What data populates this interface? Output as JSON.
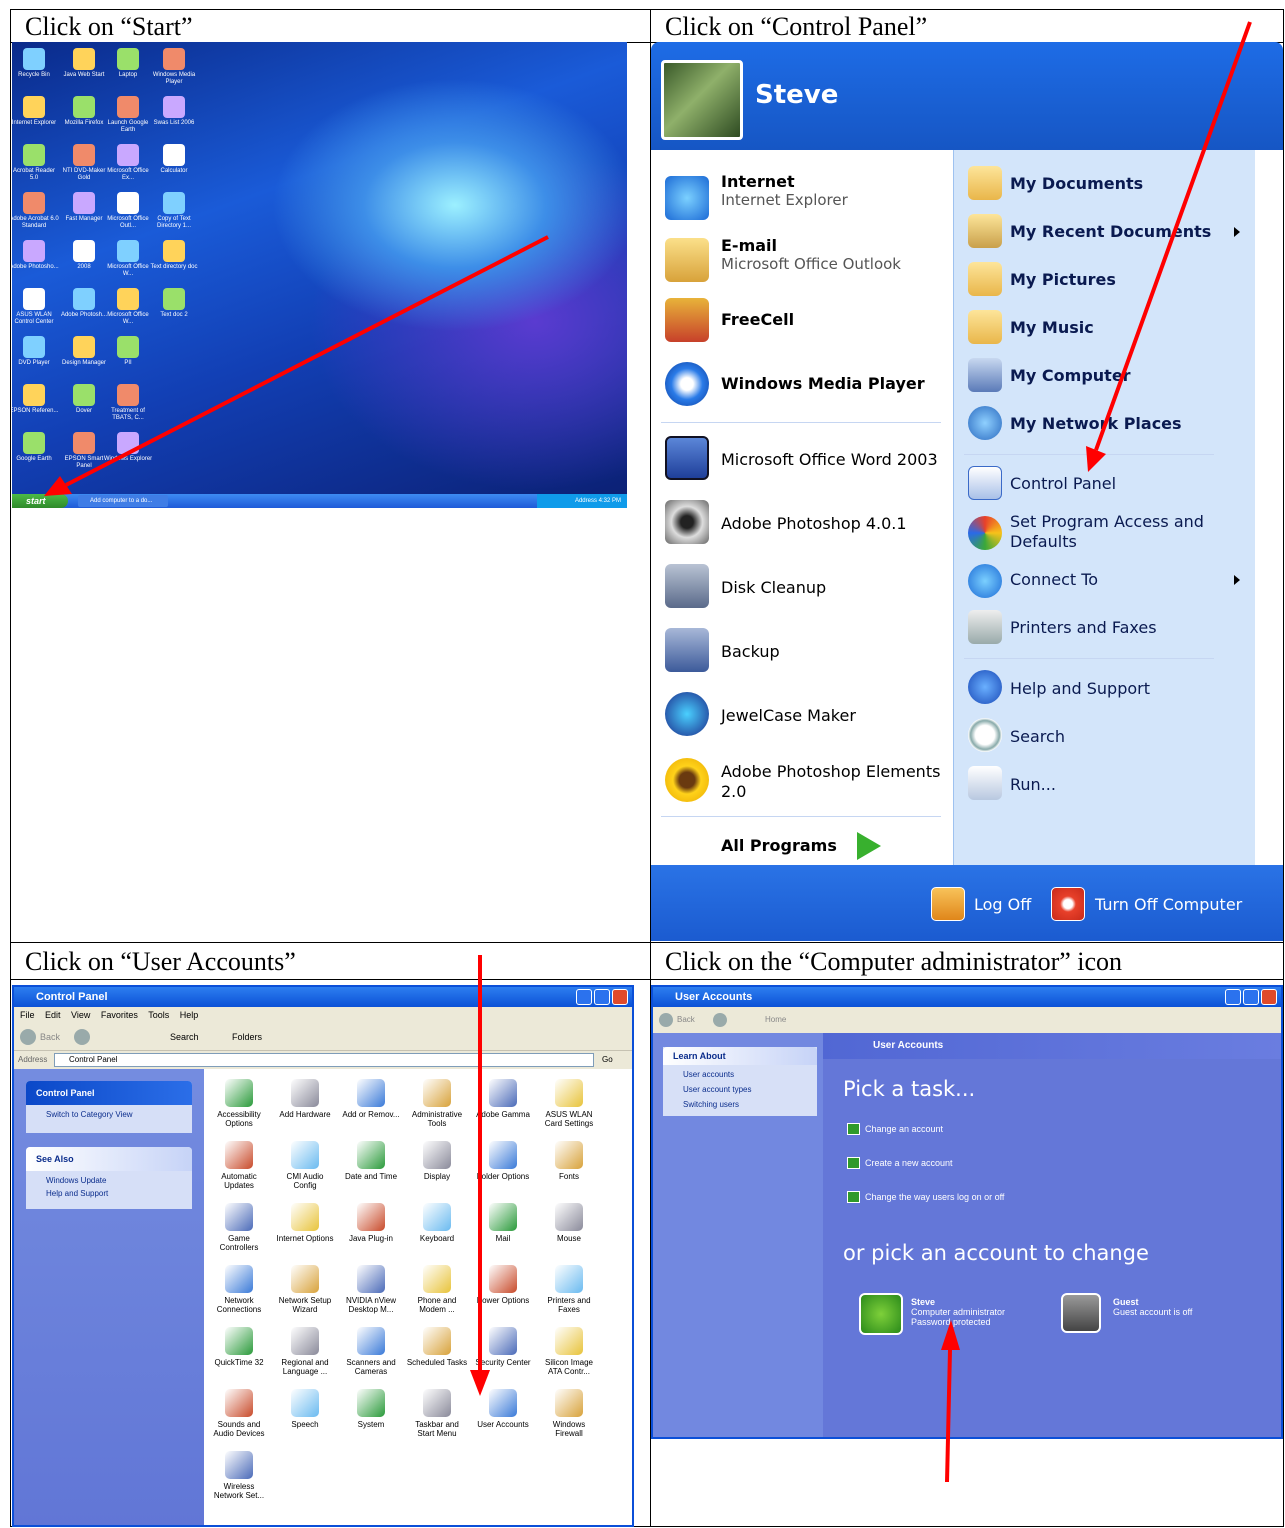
{
  "captions": {
    "c1": "Click on “Start”",
    "c2": "Click on “Control Panel”",
    "c3": "Click on “User Accounts”",
    "c4": "Click on the “Computer administrator” icon"
  },
  "desktop": {
    "icons": [
      [
        "Recycle Bin",
        "Java Web Start",
        "Laptop",
        "Windows Media Player"
      ],
      [
        "Internet Explorer",
        "Mozilla Firefox",
        "Launch Google Earth",
        "Swas List 2006"
      ],
      [
        "Acrobat Reader 5.0",
        "NTI DVD-Maker Gold",
        "Microsoft Office Ex...",
        "Calculator"
      ],
      [
        "Adobe Acrobat 6.0 Standard",
        "Fast Manager",
        "Microsoft Office Outl...",
        "Copy of Text Directory 1..."
      ],
      [
        "Adobe Photosho...",
        "2008",
        "Microsoft Office W...",
        "Text directory doc"
      ],
      [
        "ASUS WLAN Control Center",
        "Adobe Photosh...",
        "Microsoft Office W...",
        "Text doc 2"
      ],
      [
        "DVD Player",
        "Design Manager",
        "PII",
        ""
      ],
      [
        "EPSON Referen...",
        "Dover",
        "Treatment of TBATS, C...",
        ""
      ],
      [
        "Google Earth",
        "EPSON Smart Panel",
        "Windows Explorer",
        ""
      ]
    ],
    "start_label": "start",
    "task_label": "Add computer to a do...",
    "tray_text": "Address  4:32 PM"
  },
  "start_menu": {
    "user": "Steve",
    "left_items": [
      {
        "title": "Internet",
        "sub": "Internet Explorer"
      },
      {
        "title": "E-mail",
        "sub": "Microsoft Office Outlook"
      },
      {
        "title": "FreeCell",
        "sub": ""
      },
      {
        "title": "Windows Media Player",
        "sub": ""
      },
      {
        "title": "Microsoft Office Word 2003",
        "sub": ""
      },
      {
        "title": "Adobe Photoshop 4.0.1",
        "sub": ""
      },
      {
        "title": "Disk Cleanup",
        "sub": ""
      },
      {
        "title": "Backup",
        "sub": ""
      },
      {
        "title": "JewelCase Maker",
        "sub": ""
      },
      {
        "title": "Adobe Photoshop Elements",
        "sub": "2.0"
      }
    ],
    "all_programs": "All Programs",
    "right_items": [
      "My Documents",
      "My Recent Documents",
      "My Pictures",
      "My Music",
      "My Computer",
      "My Network Places",
      "Control Panel",
      "Set Program Access and",
      "Defaults",
      "Connect To",
      "Printers and Faxes",
      "Help and Support",
      "Search",
      "Run..."
    ],
    "log_off": "Log Off",
    "turn_off": "Turn Off Computer"
  },
  "control_panel": {
    "title": "Control Panel",
    "menu": "File  Edit  View  Favorites  Tools  Help",
    "toolbar": {
      "back": "Back",
      "search": "Search",
      "folders": "Folders"
    },
    "address_label": "Address",
    "address_value": "Control Panel",
    "go": "Go",
    "side": {
      "panel_title": "Control Panel",
      "switch": "Switch to Category View",
      "see_also": "See Also",
      "links": [
        "Windows Update",
        "Help and Support"
      ]
    },
    "items": [
      "Accessibility Options",
      "Add Hardware",
      "Add or Remov...",
      "Administrative Tools",
      "Adobe Gamma",
      "ASUS WLAN Card Settings",
      "Automatic Updates",
      "CMI Audio Config",
      "Date and Time",
      "Display",
      "Folder Options",
      "Fonts",
      "Game Controllers",
      "Internet Options",
      "Java Plug-in",
      "Keyboard",
      "Mail",
      "Mouse",
      "Network Connections",
      "Network Setup Wizard",
      "NVIDIA nView Desktop M...",
      "Phone and Modem ...",
      "Power Options",
      "Printers and Faxes",
      "QuickTime 32",
      "Regional and Language ...",
      "Scanners and Cameras",
      "Scheduled Tasks",
      "Security Center",
      "Silicon Image ATA Contr...",
      "Sounds and Audio Devices",
      "Speech",
      "System",
      "Taskbar and Start Menu",
      "User Accounts",
      "Windows Firewall",
      "Wireless Network Set..."
    ]
  },
  "user_accounts": {
    "title": "User Accounts",
    "nav": {
      "back": "Back",
      "home": "Home"
    },
    "learn_about": "Learn About",
    "learn_links": [
      "User accounts",
      "User account types",
      "Switching users"
    ],
    "header": "User Accounts",
    "pick_task": "Pick a task...",
    "tasks": [
      "Change an account",
      "Create a new account",
      "Change the way users log on or off"
    ],
    "pick_account": "or pick an account to change",
    "accounts": [
      {
        "name": "Steve",
        "lines": [
          "Computer administrator",
          "Password protected"
        ]
      },
      {
        "name": "Guest",
        "lines": [
          "Guest account is off"
        ]
      }
    ]
  },
  "colors": {
    "arrow": "#ff0000",
    "xp_blue": "#1e6ce6"
  }
}
